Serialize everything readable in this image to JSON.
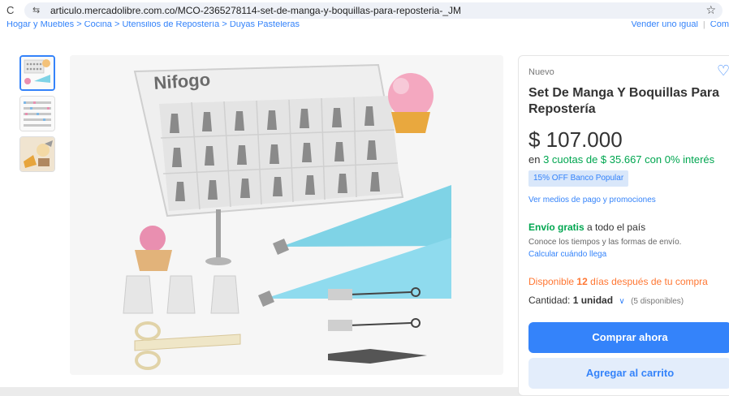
{
  "browser": {
    "url": "articulo.mercadolibre.com.co/MCO-2365278114-set-de-manga-y-boquillas-para-reposteria-_JM",
    "reload_glyph": "C",
    "site_glyph": "⇆",
    "bookmark_glyph": "☆"
  },
  "breadcrumb": {
    "text": "Hogar y Muebles > Cocina > Utensilios de Repostería > Duyas Pasteleras",
    "sell_label": "Vender uno igual",
    "sep": "|",
    "extra_label": "Com"
  },
  "product": {
    "brand": "Nifogo",
    "condition": "Nuevo",
    "title": "Set De Manga Y Boquillas Para Repostería",
    "price": "$ 107.000",
    "installments_prefix": "en",
    "installments_detail": "3 cuotas de $ 35.667 con 0% interés",
    "discount_badge": "15% OFF Banco Popular",
    "payment_link": "Ver medios de pago y promociones"
  },
  "shipping": {
    "free_label": "Envío gratis",
    "rest": "a todo el país",
    "note": "Conoce los tiempos y las formas de envío.",
    "calc_link": "Calcular cuándo llega"
  },
  "stock": {
    "prefix": "Disponible",
    "days": "12",
    "suffix": "días después de tu compra"
  },
  "quantity": {
    "label": "Cantidad:",
    "value": "1 unidad",
    "available": "(5 disponibles)"
  },
  "actions": {
    "buy_label": "Comprar ahora",
    "cart_label": "Agregar al carrito"
  },
  "icons": {
    "heart": "♡",
    "chevron": "∨"
  },
  "colors": {
    "accent": "#3483fa",
    "green": "#00a650",
    "orange": "#ff7733"
  }
}
